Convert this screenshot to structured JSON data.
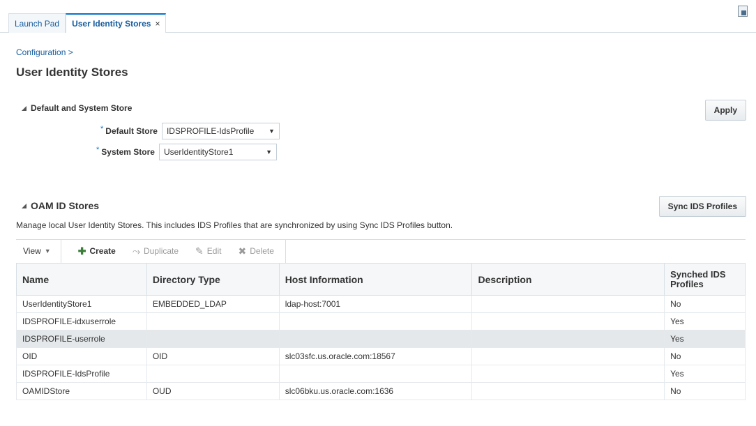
{
  "tabs": [
    {
      "label": "Launch Pad"
    },
    {
      "label": "User Identity Stores",
      "close": "×"
    }
  ],
  "breadcrumb": "Configuration >",
  "page_title": "User Identity Stores",
  "default_section": {
    "title": "Default and System Store",
    "apply_label": "Apply",
    "default_store": {
      "required": "*",
      "label": "Default Store",
      "value": "IDSPROFILE-IdsProfile"
    },
    "system_store": {
      "required": "*",
      "label": "System Store",
      "value": "UserIdentityStore1"
    }
  },
  "oam_section": {
    "title": "OAM ID Stores",
    "sync_label": "Sync IDS Profiles",
    "description": "Manage local User Identity Stores. This includes IDS Profiles that are synchronized by using Sync IDS Profiles button."
  },
  "toolbar": {
    "view": "View",
    "create": "Create",
    "duplicate": "Duplicate",
    "edit": "Edit",
    "delete": "Delete"
  },
  "table": {
    "columns": [
      "Name",
      "Directory Type",
      "Host Information",
      "Description",
      "Synched IDS Profiles"
    ],
    "rows": [
      [
        "UserIdentityStore1",
        "EMBEDDED_LDAP",
        "ldap-host:7001",
        "",
        "No"
      ],
      [
        "IDSPROFILE-idxuserrole",
        "",
        "",
        "",
        "Yes"
      ],
      [
        "IDSPROFILE-userrole",
        "",
        "",
        "",
        "Yes"
      ],
      [
        "OID",
        "OID",
        "slc03sfc.us.oracle.com:18567",
        "",
        "No"
      ],
      [
        "IDSPROFILE-IdsProfile",
        "",
        "",
        "",
        "Yes"
      ],
      [
        "OAMIDStore",
        "OUD",
        "slc06bku.us.oracle.com:1636",
        "",
        "No"
      ]
    ],
    "selected_row": 2
  },
  "colors": {
    "accent": "#0572ce",
    "link": "#145c9e",
    "selected_row": "#e4e8ea"
  }
}
